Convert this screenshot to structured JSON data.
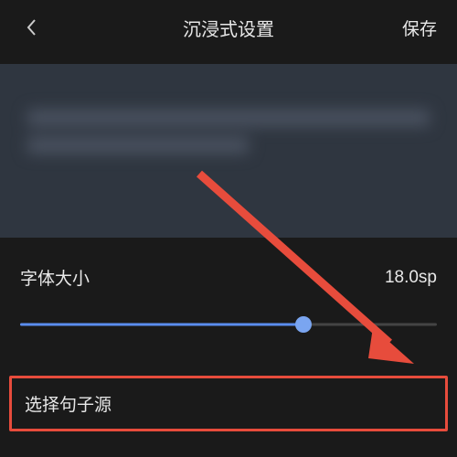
{
  "header": {
    "title": "沉浸式设置",
    "save_label": "保存"
  },
  "font_size": {
    "label": "字体大小",
    "value": "18.0sp",
    "slider_percent": 68
  },
  "select_source": {
    "label": "选择句子源"
  },
  "annotation": {
    "highlight_color": "#e74c3c"
  }
}
